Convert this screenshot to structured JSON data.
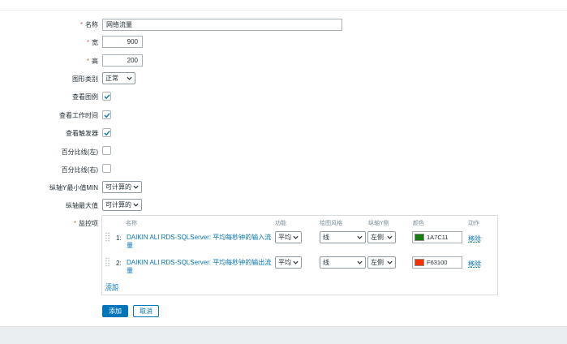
{
  "form": {
    "name": {
      "label": "名称",
      "value": "网络流量"
    },
    "width": {
      "label": "宽",
      "value": "900"
    },
    "height": {
      "label": "高",
      "value": "200"
    },
    "graph_type": {
      "label": "图形类别",
      "value": "正常"
    },
    "show_legend": {
      "label": "查看图例",
      "checked": true
    },
    "show_working_time": {
      "label": "查看工作时间",
      "checked": true
    },
    "show_triggers": {
      "label": "查看触发器",
      "checked": true
    },
    "percentile_left": {
      "label": "百分比线(左)",
      "checked": false
    },
    "percentile_right": {
      "label": "百分比线(右)",
      "checked": false
    },
    "y_min": {
      "label": "纵轴Y最小值MIN",
      "value": "可计算的"
    },
    "y_max": {
      "label": "纵轴最大值",
      "value": "可计算的"
    },
    "items_label": "监控项"
  },
  "items_table": {
    "headers": {
      "name": "名称",
      "function": "功能",
      "draw_style": "绘图风格",
      "y_axis_side": "纵轴Y侧",
      "color": "颜色",
      "action": "动作"
    },
    "rows": [
      {
        "num": "1:",
        "name_line1": "DAIKIN ALI RDS-SQLServer: 平均每秒钟的输入流",
        "name_line2": "量",
        "function": "平均",
        "draw_style": "线",
        "y_axis_side": "左侧",
        "color_hex": "1A7C11",
        "color": "#1A7C11",
        "remove": "移除"
      },
      {
        "num": "2:",
        "name_line1": "DAIKIN ALI RDS-SQLServer: 平均每秒钟的输出流",
        "name_line2": "量",
        "function": "平均",
        "draw_style": "线",
        "y_axis_side": "左侧",
        "color_hex": "F63100",
        "color": "#F63100",
        "remove": "移除"
      }
    ],
    "add_link": "添加"
  },
  "buttons": {
    "add": "添加",
    "cancel": "取消"
  },
  "colors": {
    "accent": "#0275b8",
    "required": "#e45959"
  }
}
